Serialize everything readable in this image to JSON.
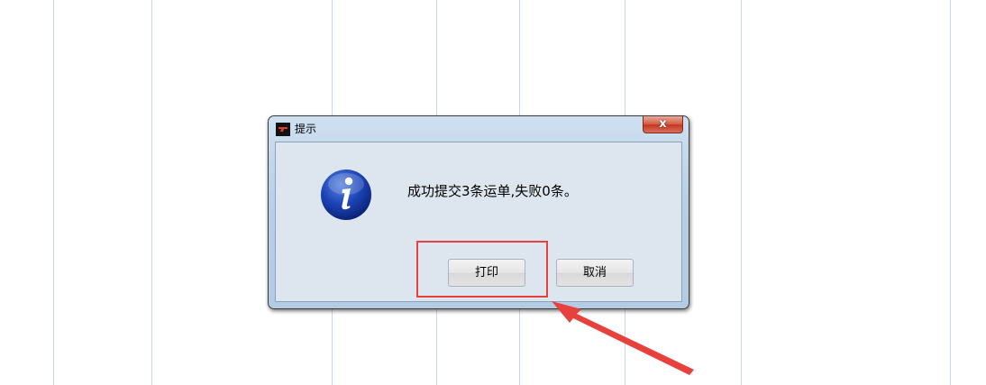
{
  "dialog": {
    "title": "提示",
    "close_label": "x",
    "message": "成功提交3条运单,失败0条。",
    "buttons": {
      "print": "打印",
      "cancel": "取消"
    },
    "icon": "info-icon"
  },
  "annotation": {
    "color": "#e8413d"
  }
}
